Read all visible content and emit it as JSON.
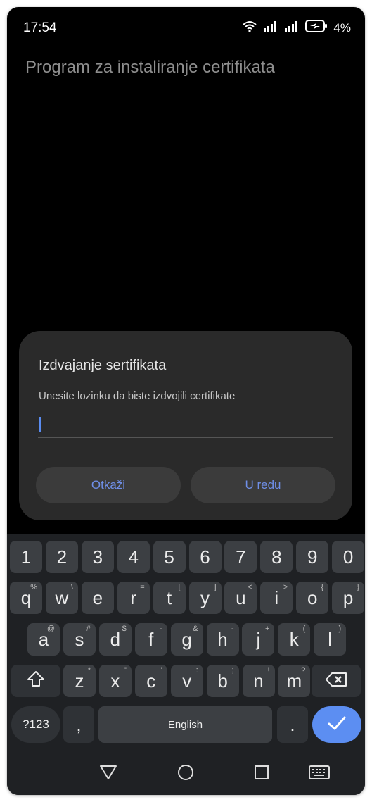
{
  "status_bar": {
    "time": "17:54",
    "battery_percent": "4%"
  },
  "app": {
    "title": "Program za instaliranje certifikata"
  },
  "dialog": {
    "title": "Izdvajanje sertifikata",
    "message": "Unesite lozinku da biste izdvojili certifikate",
    "password_value": "",
    "cancel_label": "Otkaži",
    "ok_label": "U redu"
  },
  "keyboard": {
    "number_row": [
      "1",
      "2",
      "3",
      "4",
      "5",
      "6",
      "7",
      "8",
      "9",
      "0"
    ],
    "row1": [
      {
        "k": "q",
        "h": "%"
      },
      {
        "k": "w",
        "h": "\\"
      },
      {
        "k": "e",
        "h": "|"
      },
      {
        "k": "r",
        "h": "="
      },
      {
        "k": "t",
        "h": "["
      },
      {
        "k": "y",
        "h": "]"
      },
      {
        "k": "u",
        "h": "<"
      },
      {
        "k": "i",
        "h": ">"
      },
      {
        "k": "o",
        "h": "{"
      },
      {
        "k": "p",
        "h": "}"
      }
    ],
    "row2": [
      {
        "k": "a",
        "h": "@"
      },
      {
        "k": "s",
        "h": "#"
      },
      {
        "k": "d",
        "h": "$"
      },
      {
        "k": "f",
        "h": "-"
      },
      {
        "k": "g",
        "h": "&"
      },
      {
        "k": "h",
        "h": "-"
      },
      {
        "k": "j",
        "h": "+"
      },
      {
        "k": "k",
        "h": "("
      },
      {
        "k": "l",
        "h": ")"
      }
    ],
    "row3": [
      {
        "k": "z",
        "h": "*"
      },
      {
        "k": "x",
        "h": "\""
      },
      {
        "k": "c",
        "h": "'"
      },
      {
        "k": "v",
        "h": ":"
      },
      {
        "k": "b",
        "h": ";"
      },
      {
        "k": "n",
        "h": "!"
      },
      {
        "k": "m",
        "h": "?"
      }
    ],
    "symbols_label": "?123",
    "comma": ",",
    "space_label": "English",
    "period": ".",
    "icons": {
      "shift": "shift-icon",
      "backspace": "backspace-icon",
      "enter": "checkmark-icon"
    }
  },
  "colors": {
    "accent": "#5c8ef2",
    "dialog_button_text": "#6f8fe8",
    "dialog_bg": "#2a2a2a"
  },
  "nav_icons": [
    "back-triangle-icon",
    "home-circle-icon",
    "recents-square-icon",
    "keyboard-icon"
  ]
}
